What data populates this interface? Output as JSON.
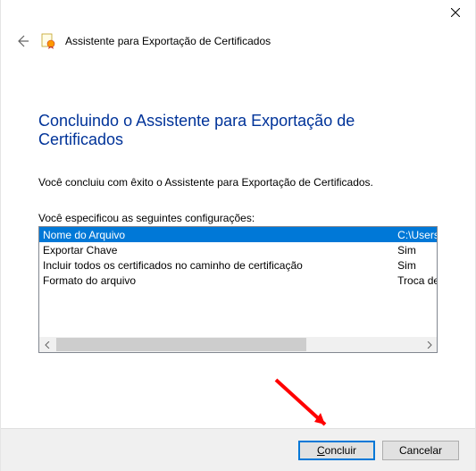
{
  "titlebar": {
    "close_name": "close"
  },
  "header": {
    "wizard_title": "Assistente para Exportação de Certificados"
  },
  "content": {
    "heading": "Concluindo o Assistente para Exportação de Certificados",
    "success_text": "Você concluiu com êxito o Assistente para Exportação de Certificados.",
    "config_label": "Você especificou as seguintes configurações:",
    "rows": [
      {
        "label": "Nome do Arquivo",
        "value": "C:\\Users\\Wesley Marques\\De",
        "selected": true
      },
      {
        "label": "Exportar Chave",
        "value": "Sim",
        "selected": false
      },
      {
        "label": "Incluir todos os certificados no caminho de certificação",
        "value": "Sim",
        "selected": false
      },
      {
        "label": "Formato do arquivo",
        "value": "Troca de Informações Pessoa",
        "selected": false
      }
    ]
  },
  "footer": {
    "finish_label": "Concluir",
    "cancel_label": "Cancelar"
  }
}
